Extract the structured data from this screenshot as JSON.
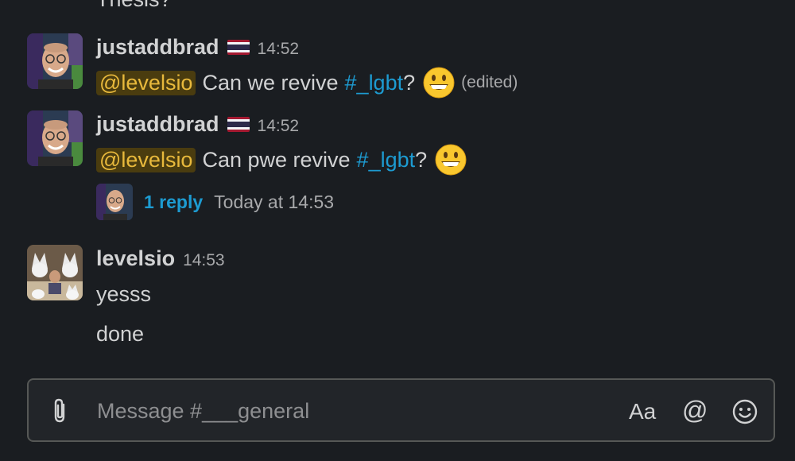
{
  "top_cutoff_text": "Thesis?",
  "messages": [
    {
      "username": "justaddbrad",
      "time": "14:52",
      "mention": "@levelsio",
      "text_before": "Can we revive",
      "channel": "#_lgbt",
      "text_after": "?",
      "edited": "(edited)"
    },
    {
      "username": "justaddbrad",
      "time": "14:52",
      "mention": "@levelsio",
      "text_before": "Can pwe revive",
      "channel": "#_lgbt",
      "text_after": "?",
      "thread": {
        "reply_count": "1 reply",
        "last_reply": "Today at 14:53"
      }
    },
    {
      "username": "levelsio",
      "time": "14:53",
      "lines": [
        "yesss",
        "done"
      ]
    }
  ],
  "composer": {
    "placeholder": "Message #___general",
    "format_label": "Aa",
    "mention_label": "@",
    "icons": [
      "paperclip-icon",
      "format-icon",
      "mention-icon",
      "emoji-icon"
    ]
  },
  "colors": {
    "background": "#1a1d21",
    "mention_bg": "#4a3c0f",
    "mention_fg": "#e8b93c",
    "link": "#1d9bd1"
  }
}
